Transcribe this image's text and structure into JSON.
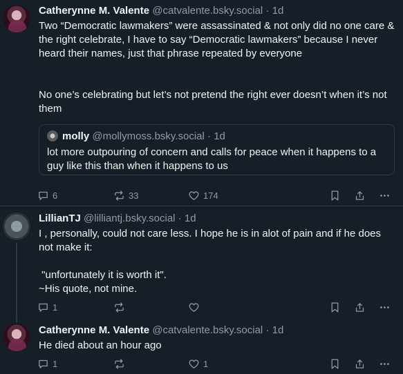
{
  "posts": [
    {
      "name": "Catherynne M. Valente",
      "handle": "@catvalente.bsky.social",
      "time": "1d",
      "text1": "Two “Democratic lawmakers” were assassinated & not only did no one care & the right celebrate, I have to say “Democratic lawmakers” because I never heard their names, just that phrase repeated by everyone",
      "text2": "No one’s celebrating but let’s not pretend the right ever doesn’t when it’s not them",
      "quote": {
        "name": "molly",
        "handle": "@mollymoss.bsky.social",
        "time": "1d",
        "text": "lot more outpouring of concern and calls for peace when it happens to a guy like this than when it happens to us"
      },
      "replies": "6",
      "reposts": "33",
      "likes": "174"
    },
    {
      "name": "LillianTJ",
      "handle": "@lilliantj.bsky.social",
      "time": "1d",
      "text1": "I , personally, could not care less. I hope he is in alot of pain and if he does not make it:",
      "text2": " \"unfortunately it is worth it\".",
      "text3": "~His quote, not mine.",
      "replies": "1",
      "reposts": "",
      "likes": ""
    },
    {
      "name": "Catherynne M. Valente",
      "handle": "@catvalente.bsky.social",
      "time": "1d",
      "text1": "He died about an hour ago",
      "replies": "1",
      "reposts": "",
      "likes": "1"
    }
  ],
  "icons": [
    "reply-icon",
    "repost-icon",
    "like-icon",
    "bookmark-icon",
    "share-icon",
    "more-icon"
  ],
  "colors": {
    "background": "#161e27",
    "secondary_text": "#8d9cae",
    "border": "#2e3c4a"
  }
}
